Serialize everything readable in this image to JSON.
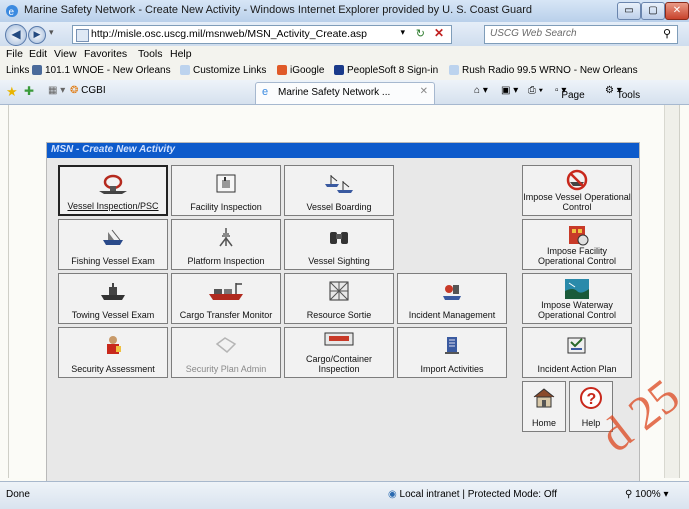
{
  "window": {
    "title": "Marine Safety Network - Create New Activity - Windows Internet Explorer provided by U. S. Coast Guard",
    "minimize": "▭",
    "maximize": "▢",
    "close": "✕"
  },
  "address": {
    "url": "http://misle.osc.uscg.mil/msnweb/MSN_Activity_Create.asp",
    "search_placeholder": "USCG Web Search"
  },
  "menu": [
    "File",
    "Edit",
    "View",
    "Favorites",
    "Tools",
    "Help"
  ],
  "links": {
    "label": "Links",
    "items": [
      "101.1 WNOE - New Orleans",
      "Customize Links",
      "iGoogle",
      "PeopleSoft 8 Sign-in",
      "Rush Radio 99.5 WRNO - New Orleans"
    ]
  },
  "tabs": {
    "cgbi": "CGBI",
    "active": "Marine Safety Network ...",
    "page_menu": "Page",
    "tools_menu": "Tools"
  },
  "panel_title": "MSN - Create New Activity",
  "buttons": {
    "vessel_inspection": "Vessel Inspection/PSC",
    "facility_inspection": "Facility Inspection",
    "vessel_boarding": "Vessel Boarding",
    "impose_vessel": "Impose Vessel Operational Control",
    "fishing_vessel": "Fishing Vessel Exam",
    "platform_inspection": "Platform Inspection",
    "vessel_sighting": "Vessel Sighting",
    "impose_facility": "Impose Facility Operational Control",
    "towing_vessel": "Towing Vessel Exam",
    "cargo_transfer": "Cargo Transfer Monitor",
    "resource_sortie": "Resource Sortie",
    "incident_management": "Incident Management",
    "impose_waterway": "Impose Waterway Operational Control",
    "security_assessment": "Security Assessment",
    "security_plan": "Security Plan Admin",
    "cargo_container": "Cargo/Container Inspection",
    "import_activities": "Import Activities",
    "incident_action_plan": "Incident Action Plan",
    "home": "Home",
    "help": "Help"
  },
  "status": {
    "left": "Done",
    "zone": "Local intranet | Protected Mode: Off",
    "zoom": "100%"
  },
  "watermark": "d 25"
}
